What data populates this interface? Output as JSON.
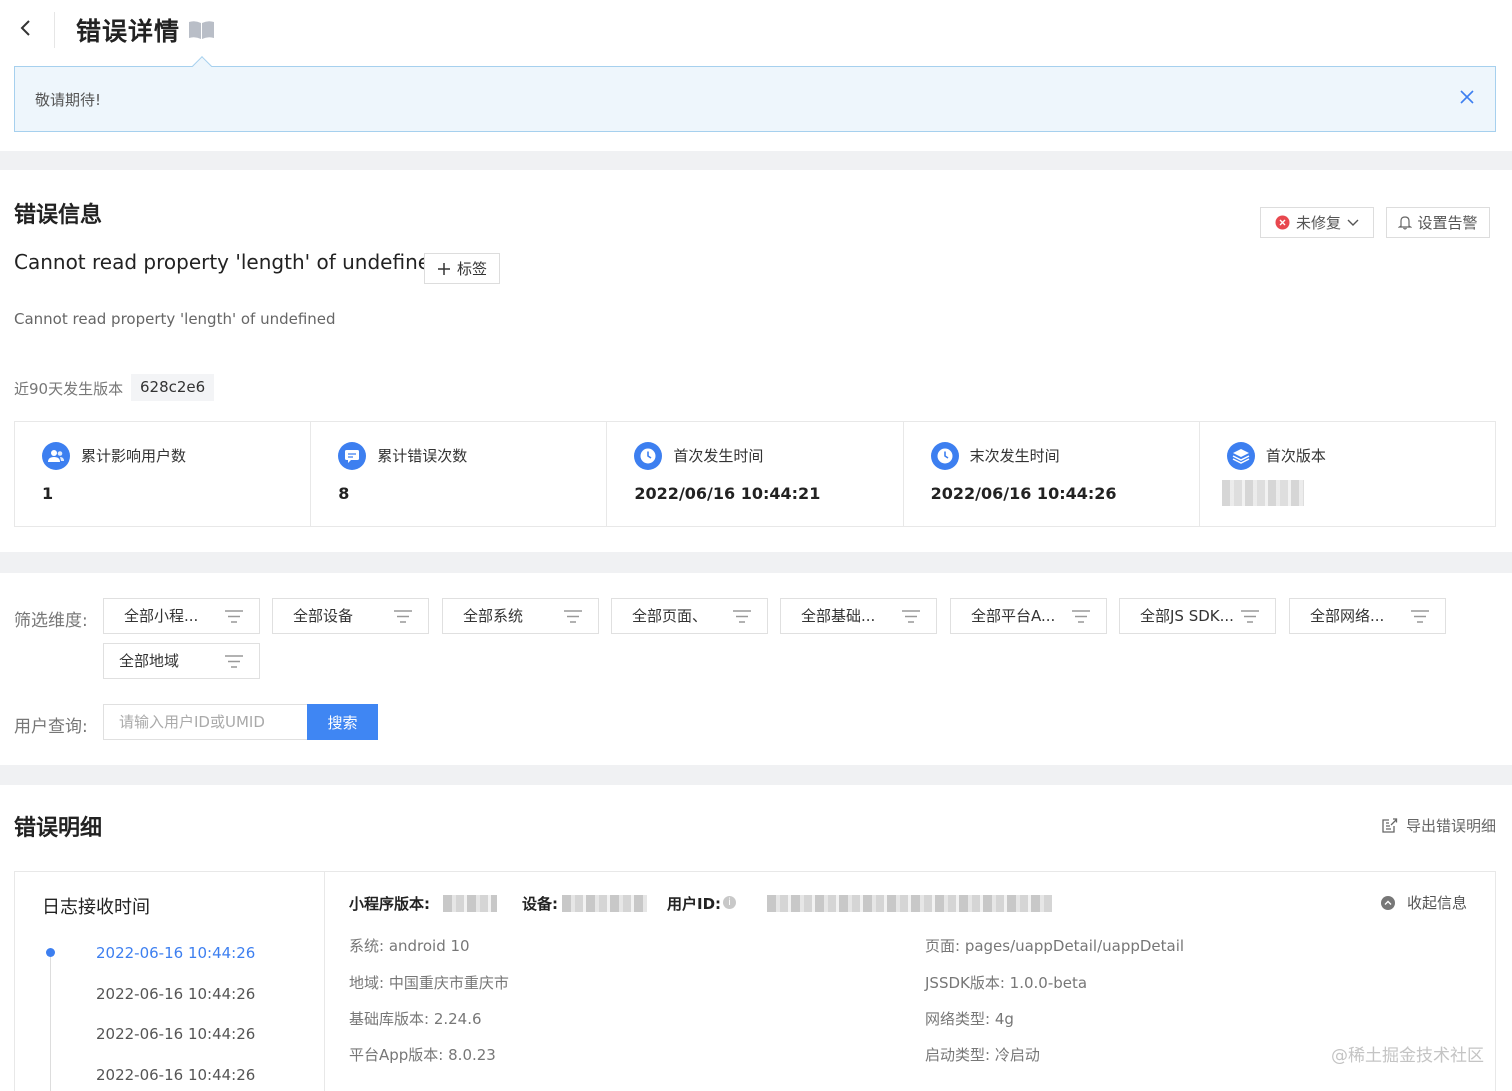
{
  "header": {
    "title": "错误详情"
  },
  "notice": {
    "text": "敬请期待!"
  },
  "error_info": {
    "section_title": "错误信息",
    "message": "Cannot read property 'length' of undefined",
    "tag_button": "标签",
    "sub_message": "Cannot read property 'length' of undefined",
    "version_label": "近90天发生版本",
    "version_value": "628c2e6",
    "status_button": "未修复",
    "alarm_button": "设置告警"
  },
  "stats": [
    {
      "label": "累计影响用户数",
      "value": "1",
      "icon": "users-icon"
    },
    {
      "label": "累计错误次数",
      "value": "8",
      "icon": "message-icon"
    },
    {
      "label": "首次发生时间",
      "value": "2022/06/16 10:44:21",
      "icon": "clock-icon"
    },
    {
      "label": "末次发生时间",
      "value": "2022/06/16 10:44:26",
      "icon": "clock-icon"
    },
    {
      "label": "首次版本",
      "value": "",
      "icon": "layers-icon"
    }
  ],
  "filters": {
    "label": "筛选维度:",
    "items": [
      "全部小程...",
      "全部设备",
      "全部系统",
      "全部页面、",
      "全部基础...",
      "全部平台A...",
      "全部JS SDK...",
      "全部网络...",
      "全部地域"
    ]
  },
  "user_query": {
    "label": "用户查询:",
    "placeholder": "请输入用户ID或UMID",
    "button": "搜索"
  },
  "error_detail": {
    "section_title": "错误明细",
    "export_button": "导出错误明细",
    "log_title": "日志接收时间",
    "log_times": [
      "2022-06-16 10:44:26",
      "2022-06-16 10:44:26",
      "2022-06-16 10:44:26",
      "2022-06-16 10:44:26"
    ],
    "miniapp_version_label": "小程序版本:",
    "device_label": "设备:",
    "user_id_label": "用户ID:",
    "collapse_button": "收起信息",
    "system": "系统: android 10",
    "region": "地域: 中国重庆市重庆市",
    "base_lib": "基础库版本: 2.24.6",
    "platform_app": "平台App版本: 8.0.23",
    "page": "页面: pages/uappDetail/uappDetail",
    "jssdk": "JSSDK版本: 1.0.0-beta",
    "network": "网络类型: 4g",
    "launch": "启动类型: 冷启动"
  },
  "watermark": "@稀土掘金技术社区",
  "colors": {
    "accent": "#3d7ff0",
    "notice_bg": "#eef6fc",
    "notice_border": "#a6d0ee",
    "error_red": "#e8484f"
  }
}
